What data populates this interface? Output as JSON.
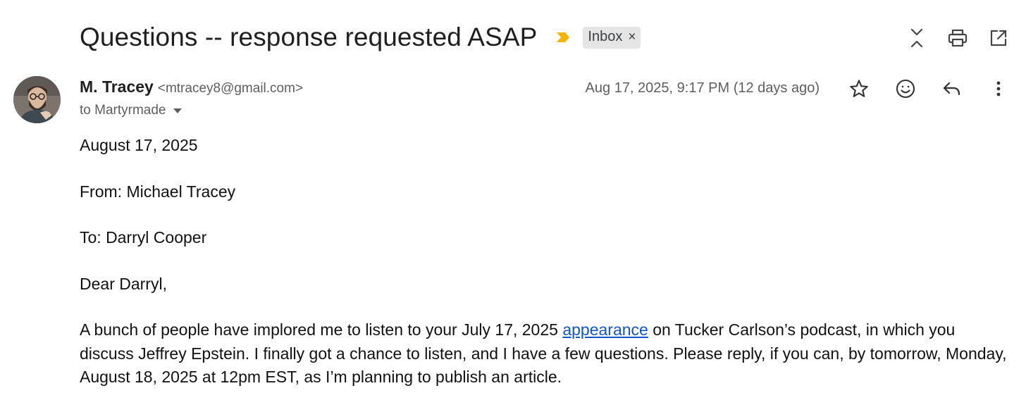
{
  "email": {
    "subject": "Questions -- response requested ASAP",
    "label": "Inbox",
    "label_remove": "×",
    "sender_name": "M. Tracey",
    "sender_email": "<mtracey8@gmail.com>",
    "recipient": "to Martyrmade",
    "date": "Aug 17, 2025, 9:17 PM (12 days ago)"
  },
  "body": {
    "date_line": "August 17, 2025",
    "from_line": "From: Michael Tracey",
    "to_line": "To: Darryl Cooper",
    "greeting": "Dear Darryl,",
    "para_before_link": "A bunch of people have implored me to listen to your July 17, 2025 ",
    "link_text": "appearance",
    "para_after_link": " on Tucker Carlson’s podcast, in which you discuss Jeffrey Epstein. I finally got a chance to listen, and I have a few questions. Please reply, if you can, by tomorrow, Monday, August 18, 2025 at 12pm EST, as I’m planning to publish an article."
  },
  "icons": {
    "top": [
      "collapse-all-icon",
      "print-icon",
      "open-in-new-window-icon"
    ],
    "message": [
      "star-icon",
      "emoji-react-icon",
      "reply-icon",
      "more-vert-icon"
    ],
    "importance": "importance-marker-icon",
    "recipient_details": "chevron-down-icon"
  },
  "colors": {
    "importance_marker": "#f4b400",
    "label_chip_bg": "#e5e5e5",
    "link": "#1155cc"
  }
}
